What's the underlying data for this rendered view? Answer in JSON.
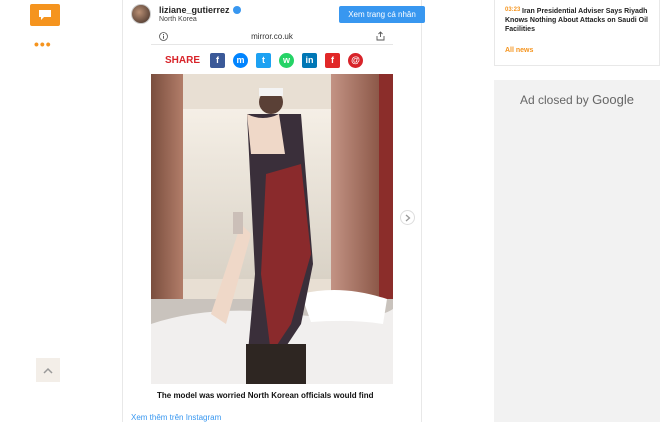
{
  "left_rail": {
    "comment_icon": "speech-bubble-icon",
    "more_icon": "more-dots-icon",
    "more_text": "•••",
    "scroll_top_icon": "chevron-up-icon"
  },
  "instagram": {
    "username": "liziane_gutierrez",
    "location": "North Korea",
    "view_profile_label": "Xem trang cá nhân",
    "view_more_label": "Xem thêm trên Instagram"
  },
  "browser": {
    "url": "mirror.co.uk"
  },
  "share": {
    "label": "SHARE",
    "buttons": [
      {
        "name": "facebook",
        "glyph": "f",
        "color": "#3b5998"
      },
      {
        "name": "messenger",
        "glyph": "m",
        "color": "#0084ff"
      },
      {
        "name": "twitter",
        "glyph": "t",
        "color": "#1da1f2"
      },
      {
        "name": "whatsapp",
        "glyph": "w",
        "color": "#25d366"
      },
      {
        "name": "linkedin",
        "glyph": "in",
        "color": "#0077b5"
      },
      {
        "name": "flipboard",
        "glyph": "f",
        "color": "#e12828"
      },
      {
        "name": "email",
        "glyph": "@",
        "color": "#d8242a"
      }
    ]
  },
  "post": {
    "caption": "The model was worried North Korean officials would find"
  },
  "news": {
    "time": "03:23",
    "headline": "Iran Presidential Adviser Says Riyadh Knows Nothing About Attacks on Saudi Oil Facilities",
    "all_news_label": "All news"
  },
  "ad": {
    "closed_text": "Ad closed by",
    "brand": "Google"
  },
  "colors": {
    "accent": "#f5941e",
    "instagram_blue": "#3897f0",
    "share_red": "#d8242a"
  }
}
